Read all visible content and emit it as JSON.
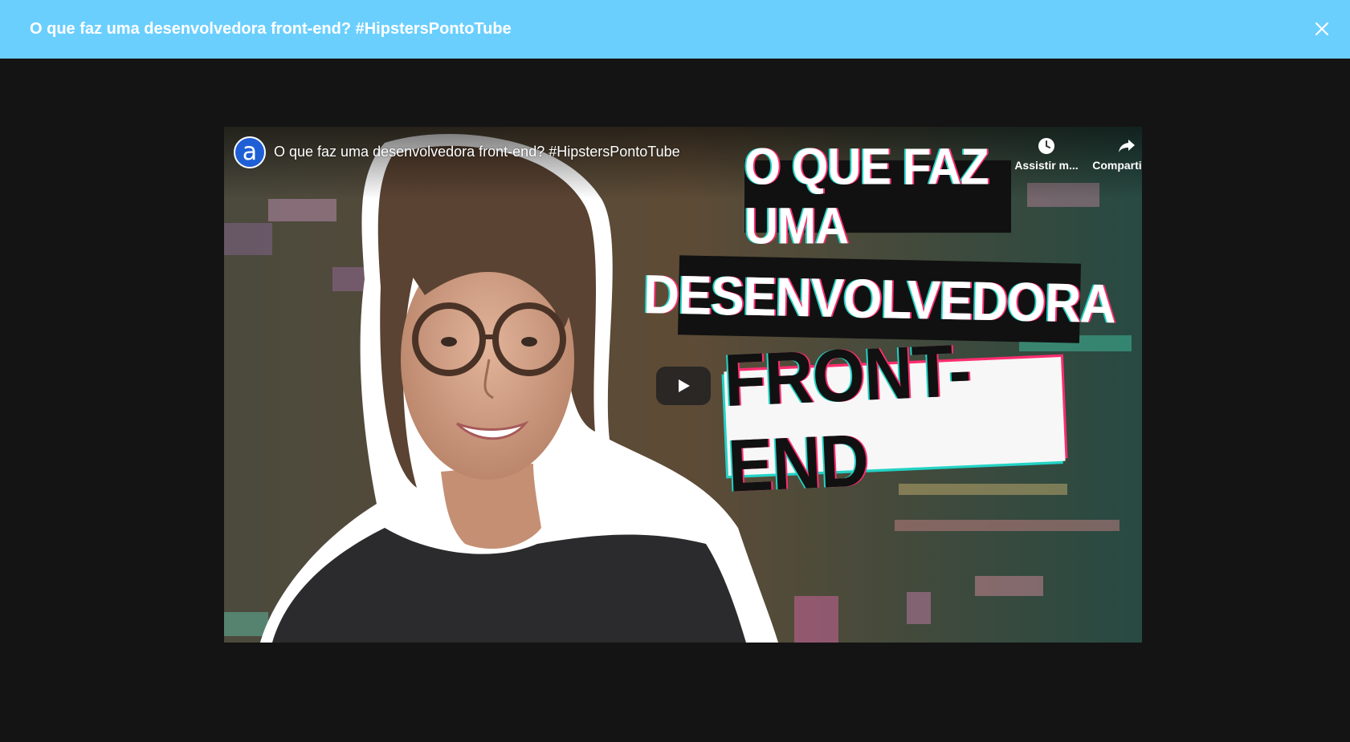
{
  "modal": {
    "title": "O que faz uma desenvolvedora front-end? #HipstersPontoTube",
    "close_icon": "close-icon"
  },
  "player": {
    "channel_avatar_letter": "a",
    "video_title": "O que faz uma desenvolvedora front-end? #HipstersPontoTube",
    "watch_later_label": "Assistir m...",
    "share_label": "Compartilh...",
    "play_icon": "play-icon",
    "thumbnail_text": {
      "line1": "O QUE FAZ UMA",
      "line2": "DESENVOLVEDORA",
      "line3": "FRONT-END"
    }
  },
  "colors": {
    "header_bg": "#6bcffe",
    "page_bg": "#141414",
    "channel_blue": "#1f5fd6"
  }
}
